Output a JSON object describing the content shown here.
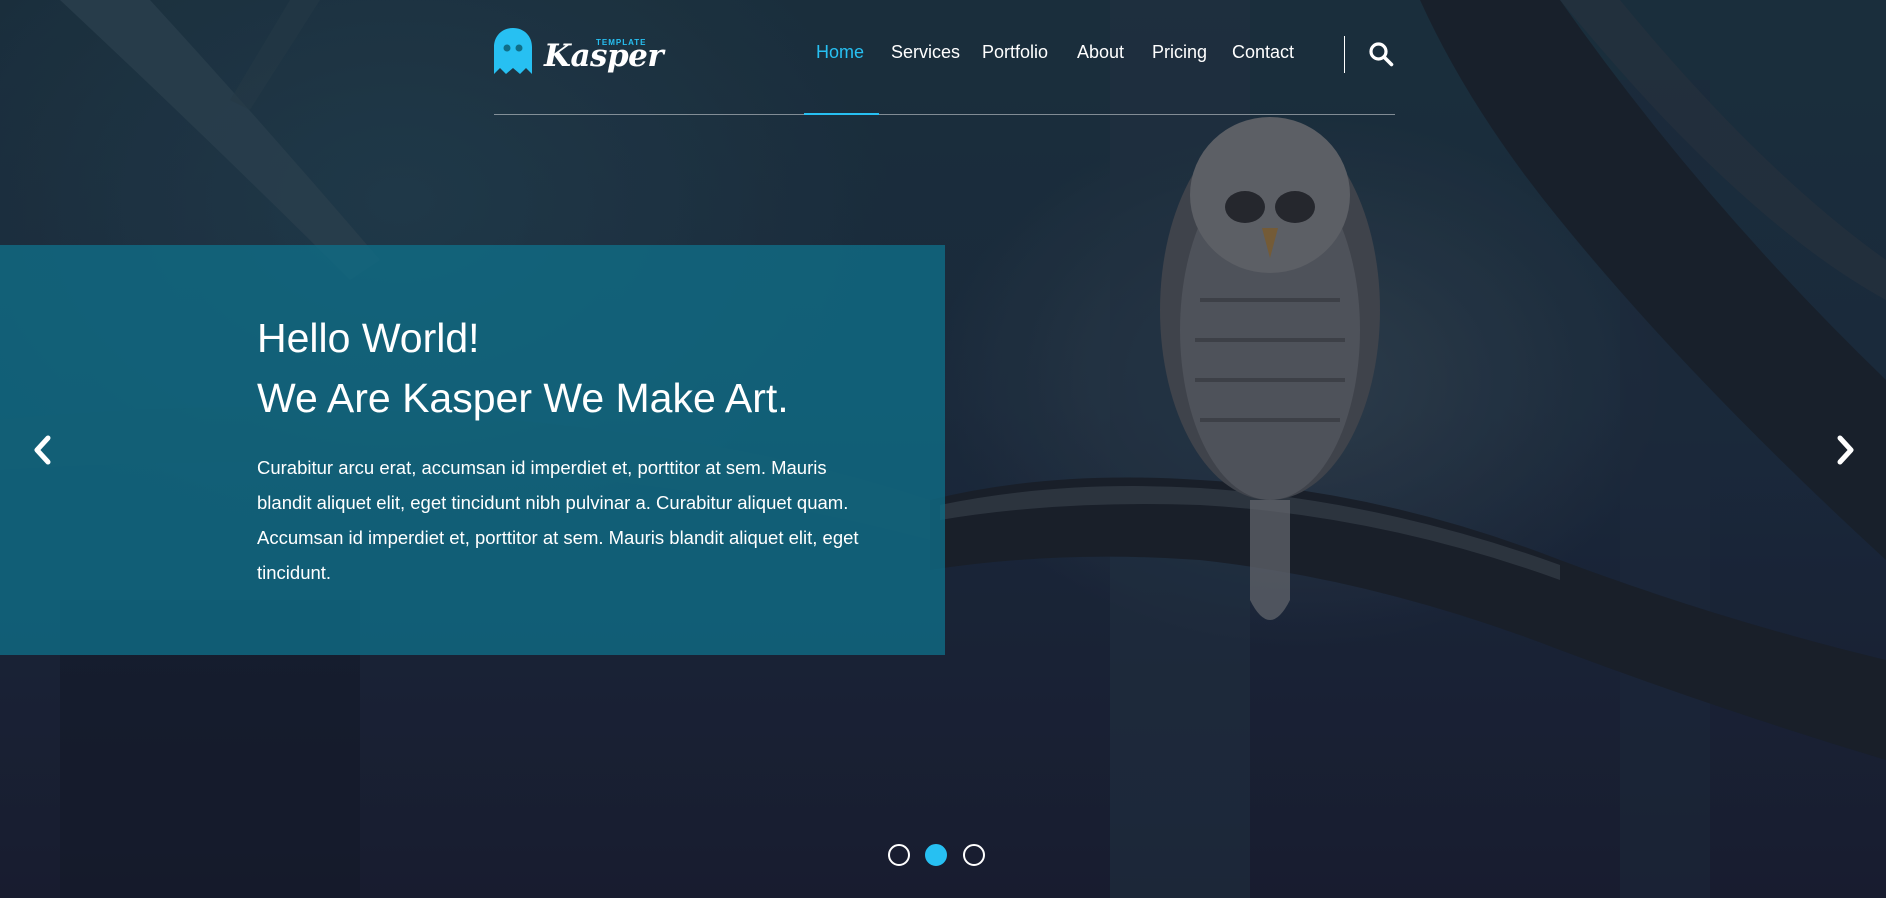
{
  "brand": {
    "name": "Kasper",
    "sub": "TEMPLATE",
    "accent": "#27c0f2"
  },
  "nav": {
    "items": [
      {
        "label": "Home",
        "active": true
      },
      {
        "label": "Services",
        "active": false
      },
      {
        "label": "Portfolio",
        "active": false
      },
      {
        "label": "About",
        "active": false
      },
      {
        "label": "Pricing",
        "active": false
      },
      {
        "label": "Contact",
        "active": false
      }
    ],
    "search_icon": "search-icon"
  },
  "slide": {
    "title_line1": "Hello World!",
    "title_line2": "We Are Kasper We Make Art.",
    "body": "Curabitur arcu erat, accumsan id imperdiet et, porttitor at sem. Mauris blandit aliquet elit, eget tincidunt nibh pulvinar a. Curabitur aliquet quam. Accumsan id imperdiet et, porttitor at sem. Mauris blandit aliquet elit, eget tincidunt.",
    "prev_icon": "chevron-left-icon",
    "next_icon": "chevron-right-icon"
  },
  "pagination": {
    "count": 3,
    "active_index": 2
  },
  "colors": {
    "caption_bg": "#106e88",
    "accent": "#27c0f2"
  }
}
